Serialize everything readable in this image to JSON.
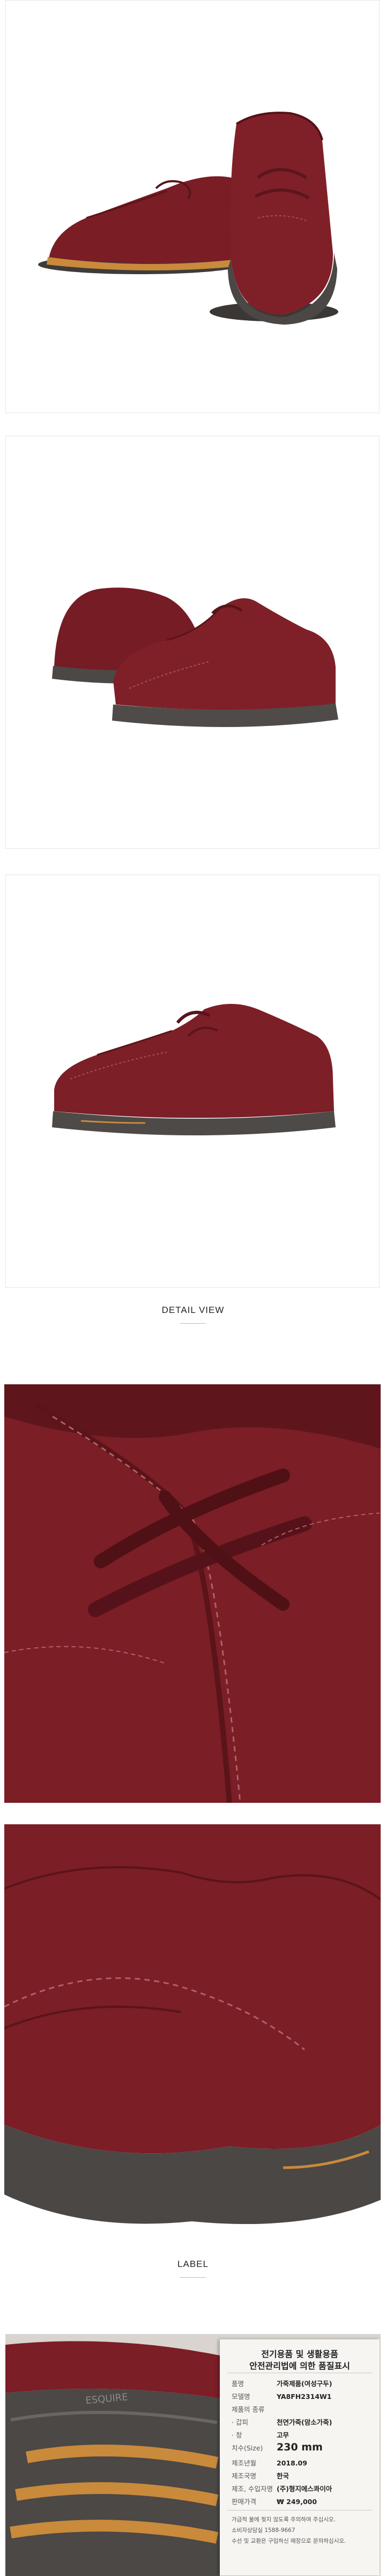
{
  "sections": {
    "detail_view": "DETAIL VIEW",
    "label": "LABEL"
  },
  "product_label": {
    "title_line_1": "전기용품 및 생활용품",
    "title_line_2": "안전관리법에 의한 품질표시",
    "rows": [
      {
        "key": "품명",
        "value": "가죽제품(여성구두)"
      },
      {
        "key": "모델명",
        "value": "YA8FH2314W1"
      },
      {
        "key": "제품의 종류",
        "value": ""
      },
      {
        "key": "· 갑피",
        "value": "천연가죽(암소가죽)"
      },
      {
        "key": "· 창",
        "value": "고무"
      },
      {
        "key": "치수(Size)",
        "value": "230 mm"
      },
      {
        "key": "제조년월",
        "value": "2018.09"
      },
      {
        "key": "제조국명",
        "value": "한국"
      },
      {
        "key": "제조, 수입자명",
        "value": "(주)형지에스콰이아"
      },
      {
        "key": "판매가격",
        "value": "₩ 249,000"
      }
    ],
    "notes": [
      "가급적 물에 젖지 않도록 주의하여 주십시오.",
      "소비자상담실 1588-9667",
      "수선 및 교환은 구입하신 매장으로 문의하십시오."
    ],
    "sole_brand": "ESQUIRE"
  },
  "colors": {
    "suede": "#7c1f27",
    "suede_dark": "#5a141a",
    "sole": "#4d4a48",
    "midsole_accent": "#c98a3c"
  }
}
